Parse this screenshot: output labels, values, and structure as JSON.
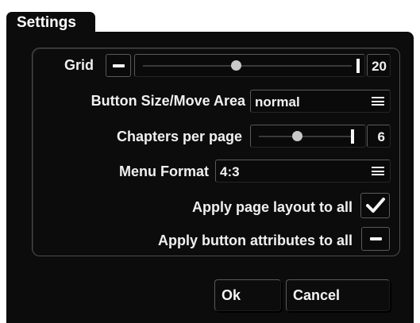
{
  "dialog": {
    "title": "Settings"
  },
  "grid": {
    "label": "Grid",
    "value": "20",
    "slider_fraction": 0.45,
    "toggle_icon": "minus-icon"
  },
  "button_size": {
    "label": "Button Size/Move Area",
    "value": "normal",
    "dropdown_icon": "menu-lines-icon"
  },
  "chapters": {
    "label": "Chapters per page",
    "value": "6",
    "slider_fraction": 0.42
  },
  "menu_format": {
    "label": "Menu Format",
    "value": "4:3",
    "dropdown_icon": "menu-lines-icon"
  },
  "apply_layout": {
    "label": "Apply page layout to all",
    "checked": true,
    "icon": "checkmark-icon"
  },
  "apply_buttons": {
    "label": "Apply button attributes to all",
    "checked": false,
    "icon": "minus-icon"
  },
  "footer": {
    "ok_label": "Ok",
    "cancel_label": "Cancel"
  },
  "colors": {
    "dialog_bg": "#0c0c0c",
    "page_bg": "#ffffff",
    "text": "#f2f2f2",
    "border": "#5a5a5a"
  }
}
